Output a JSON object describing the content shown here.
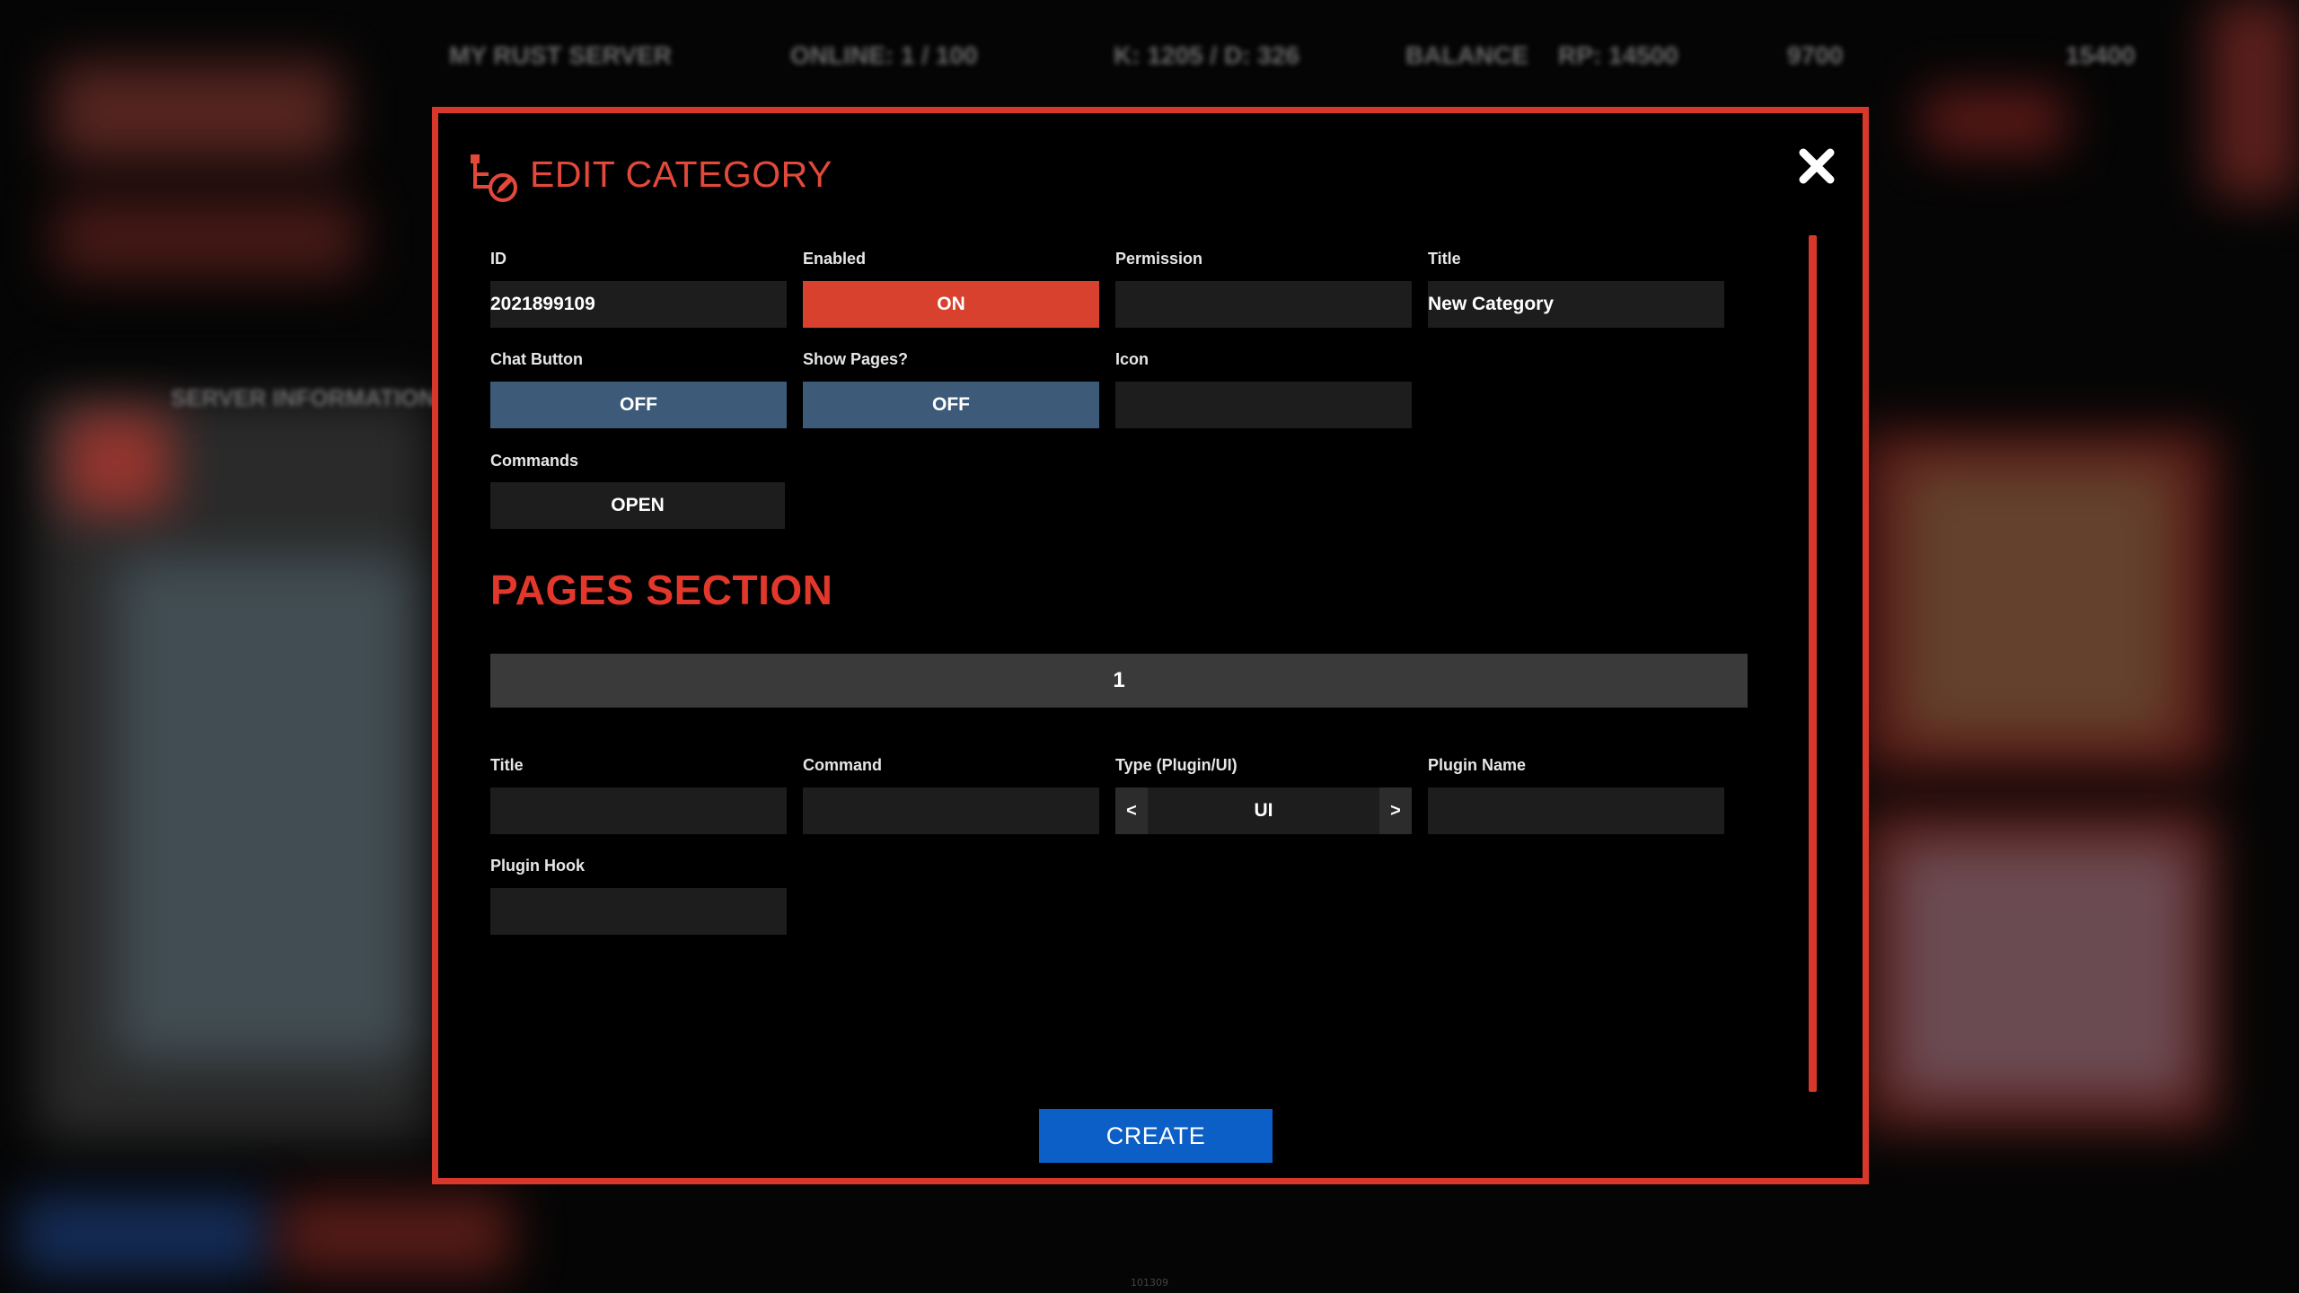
{
  "background": {
    "header_stats": [
      "MY RUST SERVER",
      "ONLINE: 1 / 100",
      "K: 1205 / D: 326",
      "BALANCE",
      "RP: 14500",
      "9700",
      "15400"
    ],
    "panel_label": "SERVER INFORMATION",
    "footer_version": "101309"
  },
  "modal": {
    "title": "EDIT CATEGORY",
    "icon": "category-edit-icon",
    "close_icon": "close-icon",
    "accent_color": "#d7382b"
  },
  "category": {
    "id_label": "ID",
    "id_value": "2021899109",
    "enabled_label": "Enabled",
    "enabled_value": "ON",
    "permission_label": "Permission",
    "permission_value": "",
    "title_label": "Title",
    "title_value": "New Category",
    "chat_button_label": "Chat Button",
    "chat_button_value": "OFF",
    "show_pages_label": "Show Pages?",
    "show_pages_value": "OFF",
    "icon_label": "Icon",
    "icon_value": "",
    "commands_label": "Commands",
    "commands_button": "OPEN"
  },
  "pages": {
    "section_title": "PAGES SECTION",
    "tabs": [
      "1"
    ],
    "title_label": "Title",
    "title_value": "",
    "command_label": "Command",
    "command_value": "",
    "type_label": "Type (Plugin/UI)",
    "type_value": "UI",
    "type_prev": "<",
    "type_next": ">",
    "plugin_name_label": "Plugin Name",
    "plugin_name_value": "",
    "plugin_hook_label": "Plugin Hook",
    "plugin_hook_value": ""
  },
  "actions": {
    "create_label": "CREATE",
    "create_color": "#0c5fc6"
  }
}
